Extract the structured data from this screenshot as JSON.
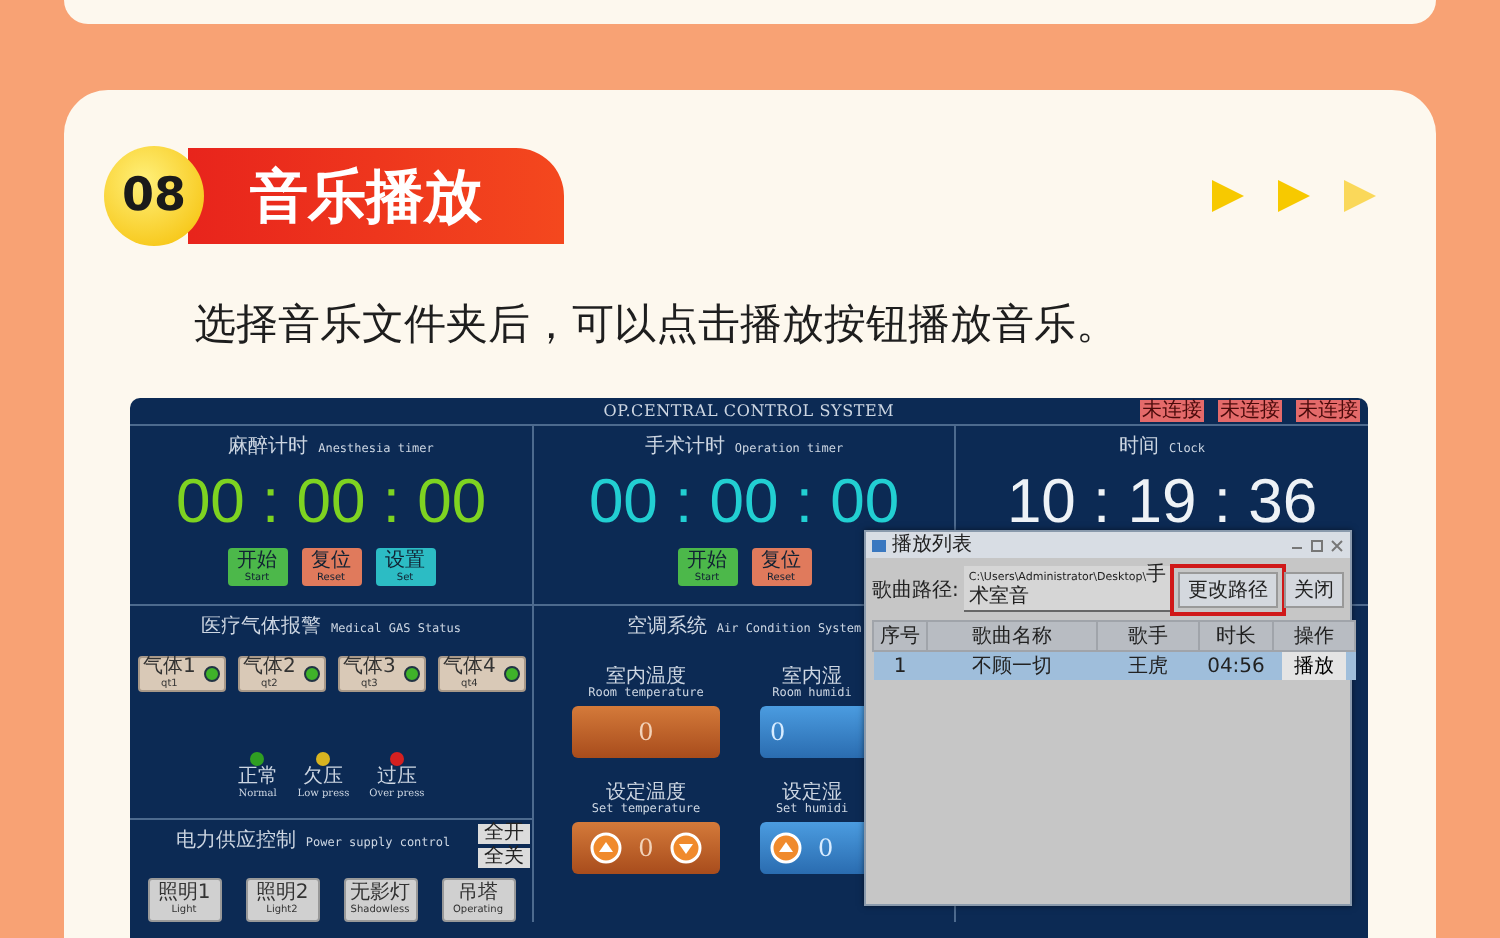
{
  "header": {
    "badge": "08",
    "title": "音乐播放"
  },
  "description": "选择音乐文件夹后，可以点击播放按钮播放音乐。",
  "app": {
    "title": "OP.CENTRAL CONTROL SYSTEM",
    "status_tags": [
      "未连接",
      "未连接",
      "未连接"
    ],
    "anesthesia_timer": {
      "title": "麻醉计时",
      "subtitle": "Anesthesia timer",
      "time": "00 : 00 : 00",
      "buttons": [
        {
          "label": "开始",
          "sublabel": "Start",
          "kind": "start"
        },
        {
          "label": "复位",
          "sublabel": "Reset",
          "kind": "reset"
        },
        {
          "label": "设置",
          "sublabel": "Set",
          "kind": "set"
        }
      ]
    },
    "operation_timer": {
      "title": "手术计时",
      "subtitle": "Operation timer",
      "time": "00 : 00 : 00",
      "buttons": [
        {
          "label": "开始",
          "sublabel": "Start",
          "kind": "start"
        },
        {
          "label": "复位",
          "sublabel": "Reset",
          "kind": "reset"
        }
      ]
    },
    "clock": {
      "title": "时间",
      "subtitle": "Clock",
      "time": "10 : 19 : 36"
    },
    "gas_status": {
      "title": "医疗气体报警",
      "subtitle": "Medical GAS Status",
      "gases": [
        {
          "label": "气体1",
          "sublabel": "qt1",
          "alarm": false
        },
        {
          "label": "气体2",
          "sublabel": "qt2",
          "alarm": false
        },
        {
          "label": "气体3",
          "sublabel": "qt3",
          "alarm": false
        },
        {
          "label": "气体4",
          "sublabel": "qt4",
          "alarm": false
        }
      ],
      "legend": [
        {
          "label": "正常",
          "sublabel": "Normal",
          "color": "#2f9e22"
        },
        {
          "label": "欠压",
          "sublabel": "Low press",
          "color": "#d8b420"
        },
        {
          "label": "过压",
          "sublabel": "Over press",
          "color": "#d42020"
        }
      ]
    },
    "power_supply": {
      "title": "电力供应控制",
      "subtitle": "Power supply control",
      "all_buttons": [
        "全开",
        "全关"
      ],
      "switches": [
        {
          "label": "照明1",
          "sublabel": "Light",
          "on": false
        },
        {
          "label": "照明2",
          "sublabel": "Light2",
          "on": false
        },
        {
          "label": "无影灯",
          "sublabel": "Shadowless",
          "on": false
        },
        {
          "label": "吊塔",
          "sublabel": "Operating",
          "on": false
        }
      ]
    },
    "air_condition": {
      "title": "空调系统",
      "subtitle": "Air Condition System",
      "readings": [
        {
          "label": "室内温度",
          "sublabel": "Room temperature",
          "value": "0",
          "kind": "temperature"
        },
        {
          "label": "室内湿",
          "sublabel": "Room humidi",
          "value": "0",
          "kind": "humidity"
        }
      ],
      "setpoints": [
        {
          "label": "设定温度",
          "sublabel": "Set temperature",
          "value": "0",
          "kind": "temperature",
          "up_arrow": true,
          "down_arrow": true
        },
        {
          "label": "设定湿",
          "sublabel": "Set humidi",
          "value": "0",
          "kind": "humidity",
          "up_arrow": true,
          "down_arrow": false
        }
      ]
    },
    "playlist_dialog": {
      "title": "播放列表",
      "path_label": "歌曲路径:",
      "path": "C:\\Users\\Administrator\\Desktop\\手术室音",
      "buttons": [
        {
          "label": "更改路径",
          "highlighted": true
        },
        {
          "label": "关闭",
          "highlighted": false
        }
      ],
      "columns": [
        "序号",
        "歌曲名称",
        "歌手",
        "时长",
        "操作"
      ],
      "rows": [
        {
          "cells": [
            "1",
            "不顾一切",
            "王虎",
            "04:56"
          ],
          "action": "播放",
          "selected": true
        }
      ]
    }
  }
}
